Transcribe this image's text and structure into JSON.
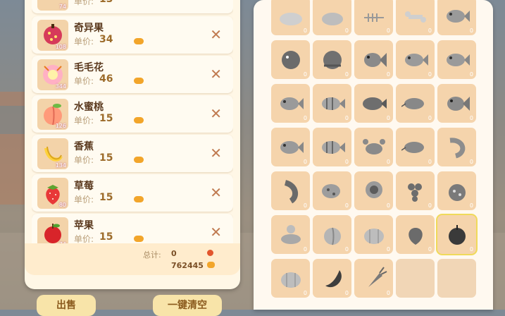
{
  "sell_panel": {
    "items": [
      {
        "name": "",
        "price_label": "单价:",
        "price": "13",
        "qty": "74"
      },
      {
        "name": "奇异果",
        "price_label": "单价:",
        "price": "34",
        "qty": "108"
      },
      {
        "name": "毛毛花",
        "price_label": "单价:",
        "price": "46",
        "qty": "344"
      },
      {
        "name": "水蜜桃",
        "price_label": "单价:",
        "price": "15",
        "qty": "126"
      },
      {
        "name": "香蕉",
        "price_label": "单价:",
        "price": "15",
        "qty": "134"
      },
      {
        "name": "草莓",
        "price_label": "单价:",
        "price": "15",
        "qty": "80"
      },
      {
        "name": "苹果",
        "price_label": "单价:",
        "price": "15",
        "qty": "74"
      }
    ],
    "total_label": "总计:",
    "total_value": "0",
    "balance": "762445",
    "sell_button": "出售",
    "clear_button": "一键清空"
  },
  "inventory": {
    "slots": [
      {
        "icon": "stone-icon",
        "count": "0"
      },
      {
        "icon": "rock-icon",
        "count": "0"
      },
      {
        "icon": "fishbone-icon",
        "count": "0"
      },
      {
        "icon": "bone-icon",
        "count": "0"
      },
      {
        "icon": "fish-icon",
        "count": "0"
      },
      {
        "icon": "pufferfish-icon",
        "count": "0"
      },
      {
        "icon": "snail-icon",
        "count": "0"
      },
      {
        "icon": "goldfish-icon",
        "count": "0"
      },
      {
        "icon": "fish-icon",
        "count": "0"
      },
      {
        "icon": "fish-icon",
        "count": "0"
      },
      {
        "icon": "fish-icon",
        "count": "0"
      },
      {
        "icon": "tropical-fish-icon",
        "count": "0"
      },
      {
        "icon": "carp-icon",
        "count": "0"
      },
      {
        "icon": "catfish-icon",
        "count": "0"
      },
      {
        "icon": "goldfish-icon",
        "count": "0"
      },
      {
        "icon": "fish-icon",
        "count": "0"
      },
      {
        "icon": "tropical-fish-icon",
        "count": "0"
      },
      {
        "icon": "crab-icon",
        "count": "0"
      },
      {
        "icon": "catfish-icon",
        "count": "0"
      },
      {
        "icon": "shrimp-icon",
        "count": "0"
      },
      {
        "icon": "lobster-icon",
        "count": "0"
      },
      {
        "icon": "spotted-fish-icon",
        "count": "0"
      },
      {
        "icon": "sunflower-icon",
        "count": "0"
      },
      {
        "icon": "grape-icon",
        "count": "0"
      },
      {
        "icon": "kiwi-icon",
        "count": "0"
      },
      {
        "icon": "flower-icon",
        "count": "0"
      },
      {
        "icon": "peach-icon",
        "count": "0"
      },
      {
        "icon": "pumpkin-icon",
        "count": "0"
      },
      {
        "icon": "strawberry-icon",
        "count": "0"
      },
      {
        "icon": "apple-icon",
        "count": "0",
        "selected": true
      },
      {
        "icon": "pumpkin-icon",
        "count": "0"
      },
      {
        "icon": "eggplant-icon",
        "count": "0"
      },
      {
        "icon": "carrot-icon",
        "count": "0"
      },
      {
        "icon": "empty-slot",
        "count": ""
      },
      {
        "icon": "empty-slot",
        "count": ""
      }
    ]
  }
}
